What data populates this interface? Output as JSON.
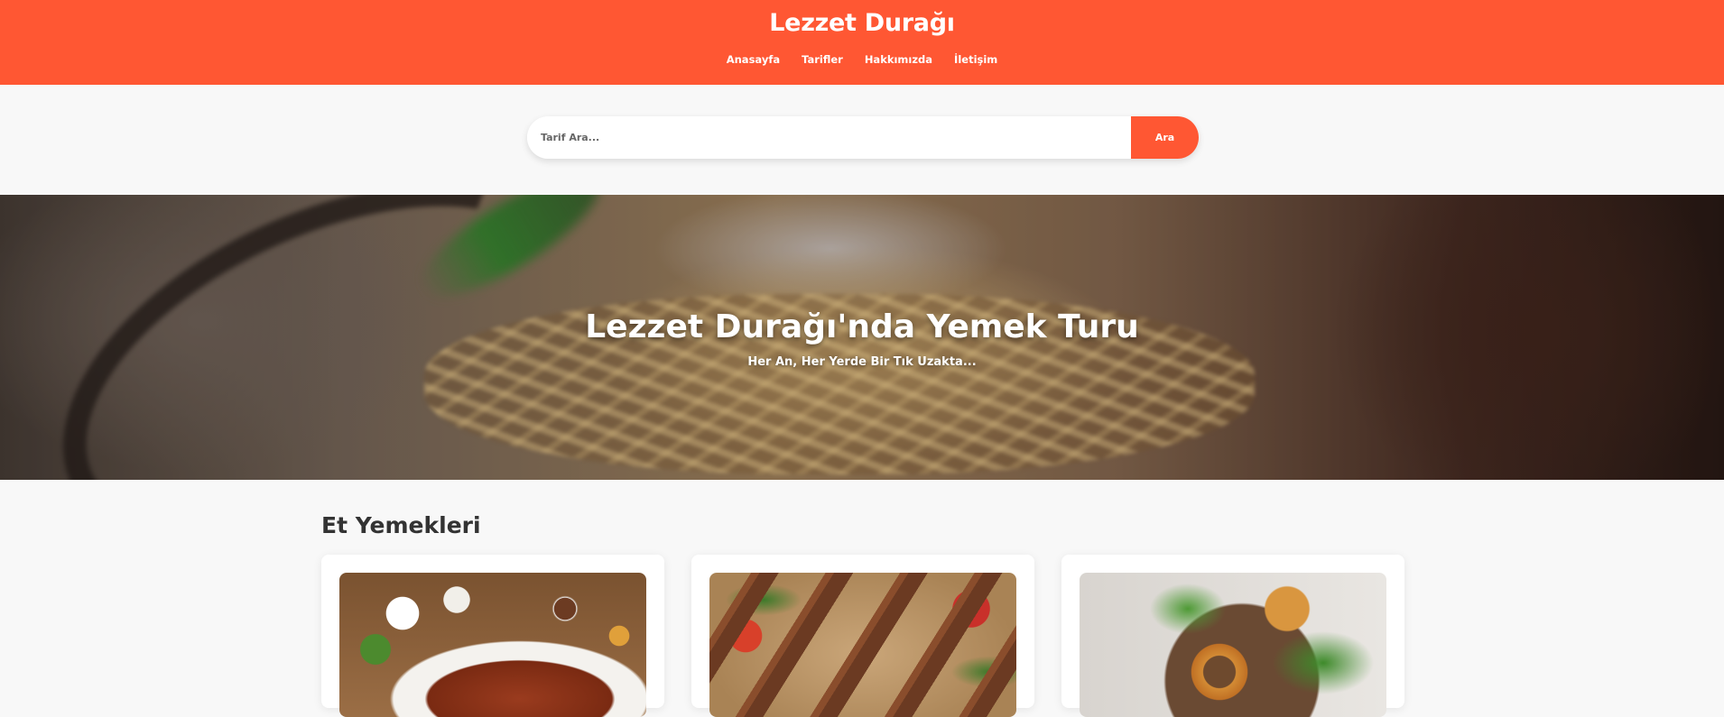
{
  "header": {
    "site_title": "Lezzet Durağı",
    "nav": [
      {
        "label": "Anasayfa"
      },
      {
        "label": "Tarifler"
      },
      {
        "label": "Hakkımızda"
      },
      {
        "label": "İletişim"
      }
    ],
    "accent_color": "#ff5733"
  },
  "search": {
    "placeholder": "Tarif Ara...",
    "value": "",
    "button_label": "Ara"
  },
  "hero": {
    "title": "Lezzet Durağı'nda Yemek Turu",
    "subtitle": "Her An, Her Yerde Bir Tık Uzakta..."
  },
  "section": {
    "title": "Et Yemekleri",
    "cards": [
      {
        "image": "iskender-plate-photo"
      },
      {
        "image": "adana-kebab-photo"
      },
      {
        "image": "icli-kofte-photo"
      }
    ]
  }
}
